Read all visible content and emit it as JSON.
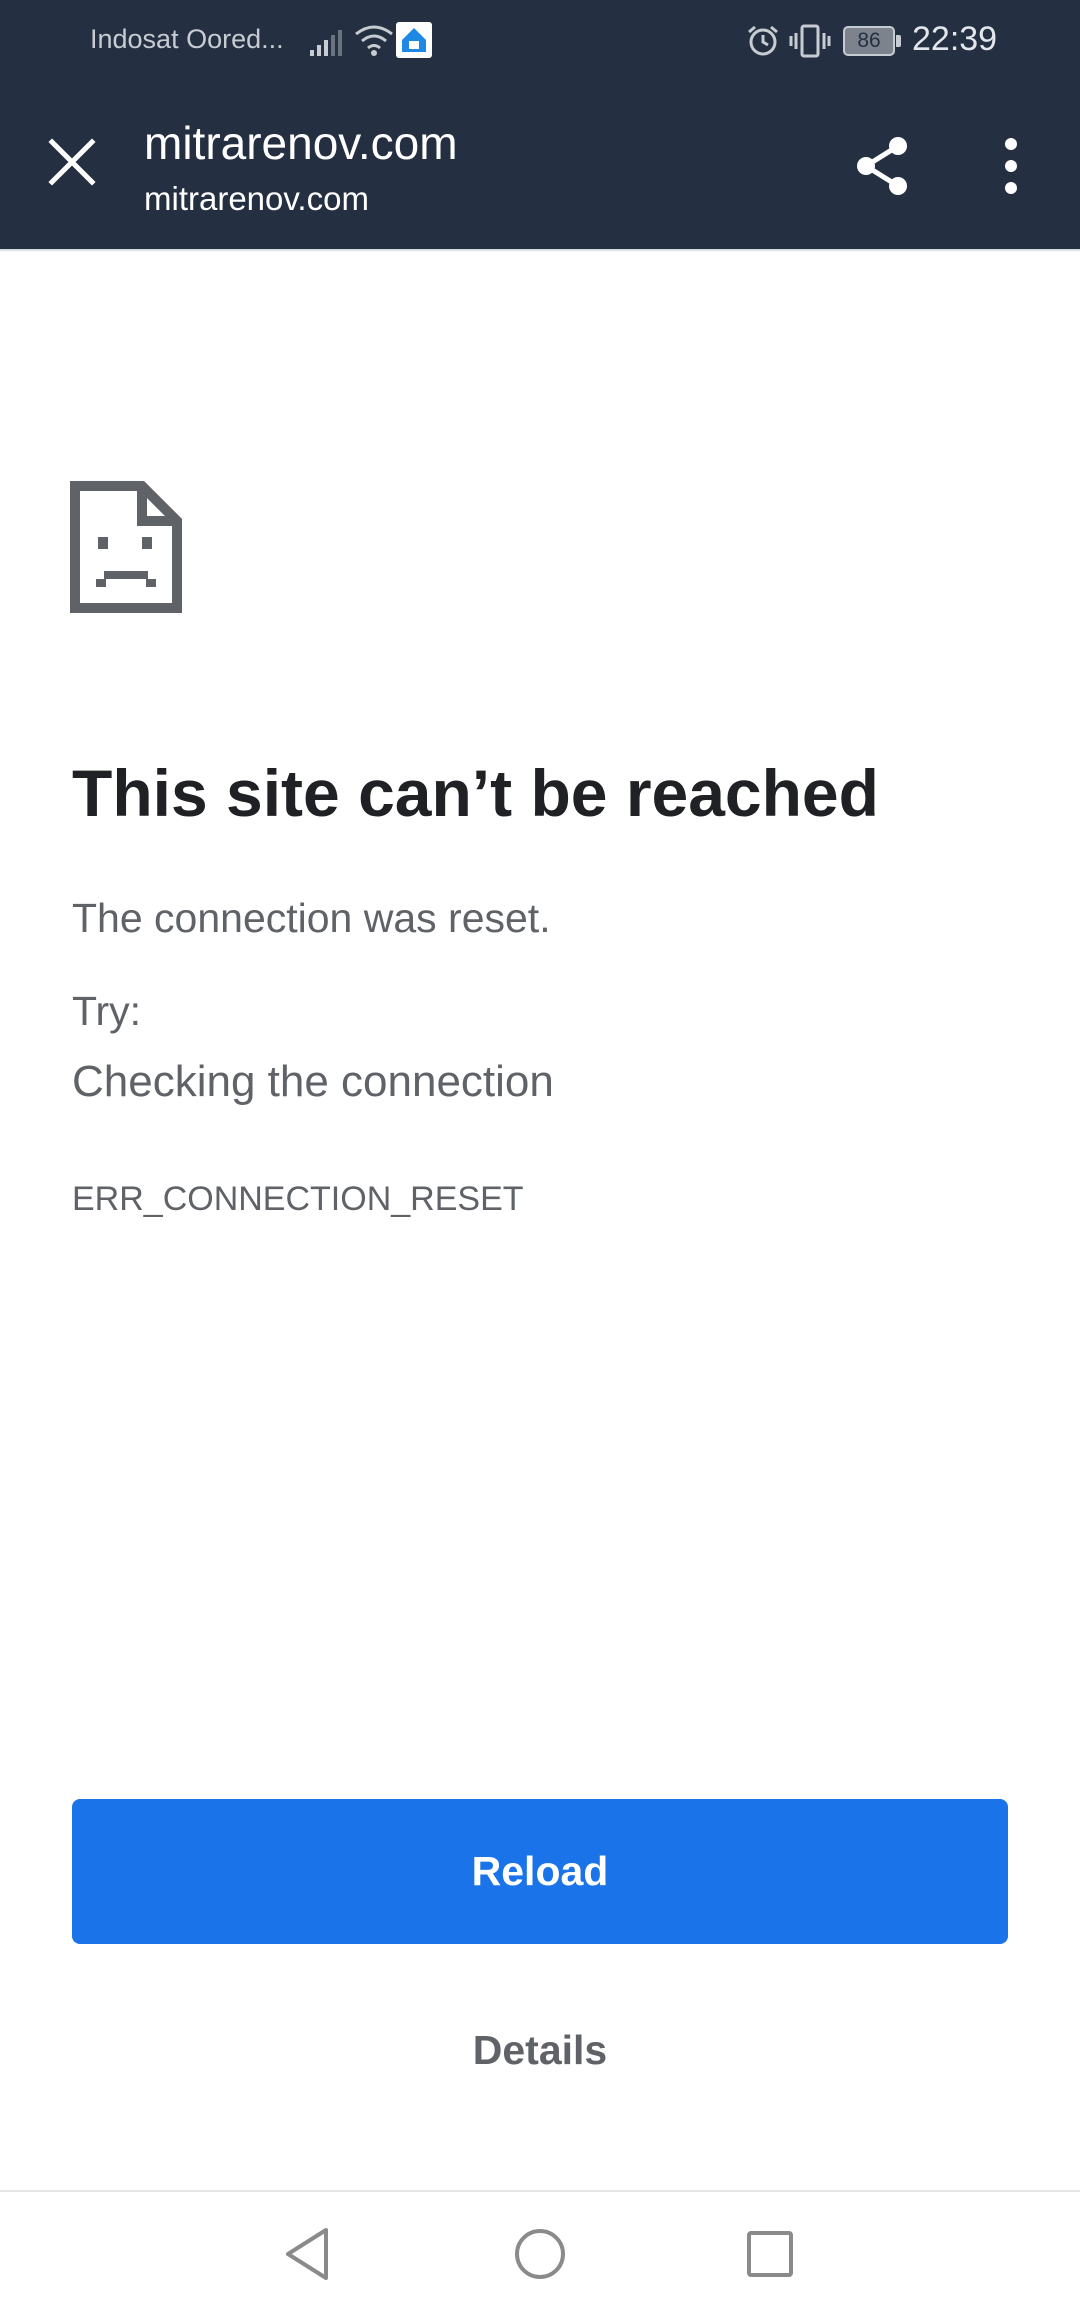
{
  "status_bar": {
    "carrier": "Indosat Oored...",
    "battery": "86",
    "time": "22:39",
    "icons": [
      "signal-icon",
      "wifi-icon",
      "app-notification-icon",
      "alarm-icon",
      "vibrate-icon",
      "battery-icon"
    ]
  },
  "toolbar": {
    "close_icon": "close-icon",
    "title": "mitrarenov.com",
    "url": "mitrarenov.com",
    "share_icon": "share-icon",
    "menu_icon": "more-vert-icon",
    "background": "#243041"
  },
  "error": {
    "icon": "sad-document-icon",
    "title": "This site can’t be reached",
    "message": "The connection was reset.",
    "try_label": "Try:",
    "suggestion": "Checking the connection",
    "code": "ERR_CONNECTION_RESET"
  },
  "actions": {
    "reload_label": "Reload",
    "details_label": "Details",
    "accent": "#1a73e8"
  },
  "nav_bar": {
    "icons": [
      "back-icon",
      "home-icon",
      "recents-icon"
    ]
  }
}
